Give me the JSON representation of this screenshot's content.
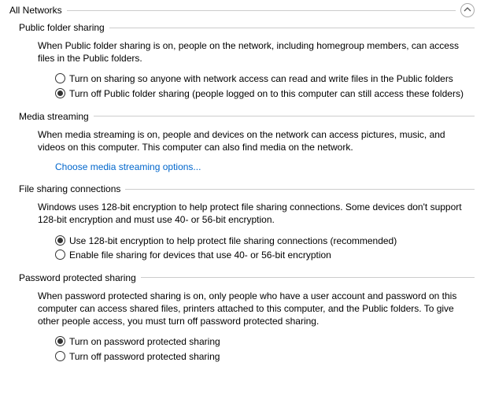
{
  "header": {
    "title": "All Networks"
  },
  "sections": {
    "public_folder": {
      "title": "Public folder sharing",
      "desc": "When Public folder sharing is on, people on the network, including homegroup members, can access files in the Public folders.",
      "opt_on": "Turn on sharing so anyone with network access can read and write files in the Public folders",
      "opt_off": "Turn off Public folder sharing (people logged on to this computer can still access these folders)"
    },
    "media": {
      "title": "Media streaming",
      "desc": "When media streaming is on, people and devices on the network can access pictures, music, and videos on this computer. This computer can also find media on the network.",
      "link": "Choose media streaming options..."
    },
    "file_sharing": {
      "title": "File sharing connections",
      "desc": "Windows uses 128-bit encryption to help protect file sharing connections. Some devices don't support 128-bit encryption and must use 40- or 56-bit encryption.",
      "opt_128": "Use 128-bit encryption to help protect file sharing connections (recommended)",
      "opt_40": "Enable file sharing for devices that use 40- or 56-bit encryption"
    },
    "password": {
      "title": "Password protected sharing",
      "desc": "When password protected sharing is on, only people who have a user account and password on this computer can access shared files, printers attached to this computer, and the Public folders. To give other people access, you must turn off password protected sharing.",
      "opt_on": "Turn on password protected sharing",
      "opt_off": "Turn off password protected sharing"
    }
  }
}
